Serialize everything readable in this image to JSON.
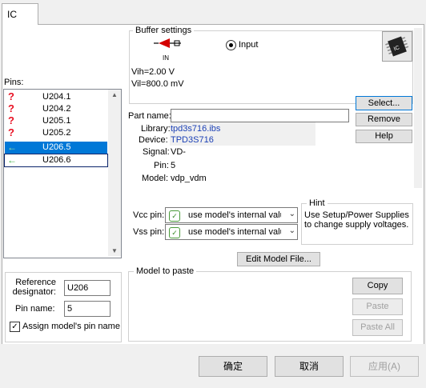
{
  "tab": {
    "label": "IC"
  },
  "buffer": {
    "legend": "Buffer settings",
    "icon_caption": "IN",
    "radio_label": "Input",
    "vih": "Vih=2.00 V",
    "vil": "Vil=800.0 mV"
  },
  "pins": {
    "label": "Pins:",
    "items": [
      {
        "name": "U204.1",
        "icon": "question-icon"
      },
      {
        "name": "U204.2",
        "icon": "question-icon"
      },
      {
        "name": "U205.1",
        "icon": "question-icon"
      },
      {
        "name": "U205.2",
        "icon": "question-icon"
      },
      {
        "name": "U206.5",
        "icon": "arrow-left-icon"
      },
      {
        "name": "U206.6",
        "icon": "arrow-left-icon"
      }
    ]
  },
  "part": {
    "name_label": "Part name:",
    "name_value": "",
    "library_label": "Library:",
    "library_value": "tpd3s716.ibs",
    "device_label": "Device:",
    "device_value": "TPD3S716",
    "signal_label": "Signal:",
    "signal_value": "VD-",
    "pin_label": "Pin:",
    "pin_value": "5",
    "model_label": "Model:",
    "model_value": "vdp_vdm"
  },
  "buttons": {
    "select": "Select...",
    "remove": "Remove",
    "help": "Help",
    "edit_model": "Edit Model File...",
    "copy": "Copy",
    "paste": "Paste",
    "paste_all": "Paste All",
    "ok": "确定",
    "cancel": "取消",
    "apply": "应用(A)"
  },
  "supply": {
    "vcc_label": "Vcc pin:",
    "vcc_value": "use model's internal valu",
    "vss_label": "Vss pin:",
    "vss_value": "use model's internal valu",
    "hint_legend": "Hint",
    "hint_text": "Use Setup/Power Supplies to change supply voltages."
  },
  "reference": {
    "designator_label": "Reference designator:",
    "designator_value": "U206",
    "pin_name_label": "Pin name:",
    "pin_name_value": "5",
    "assign_label": "Assign model's pin name",
    "assign_checked": true
  },
  "paste_group": {
    "legend": "Model to paste"
  }
}
